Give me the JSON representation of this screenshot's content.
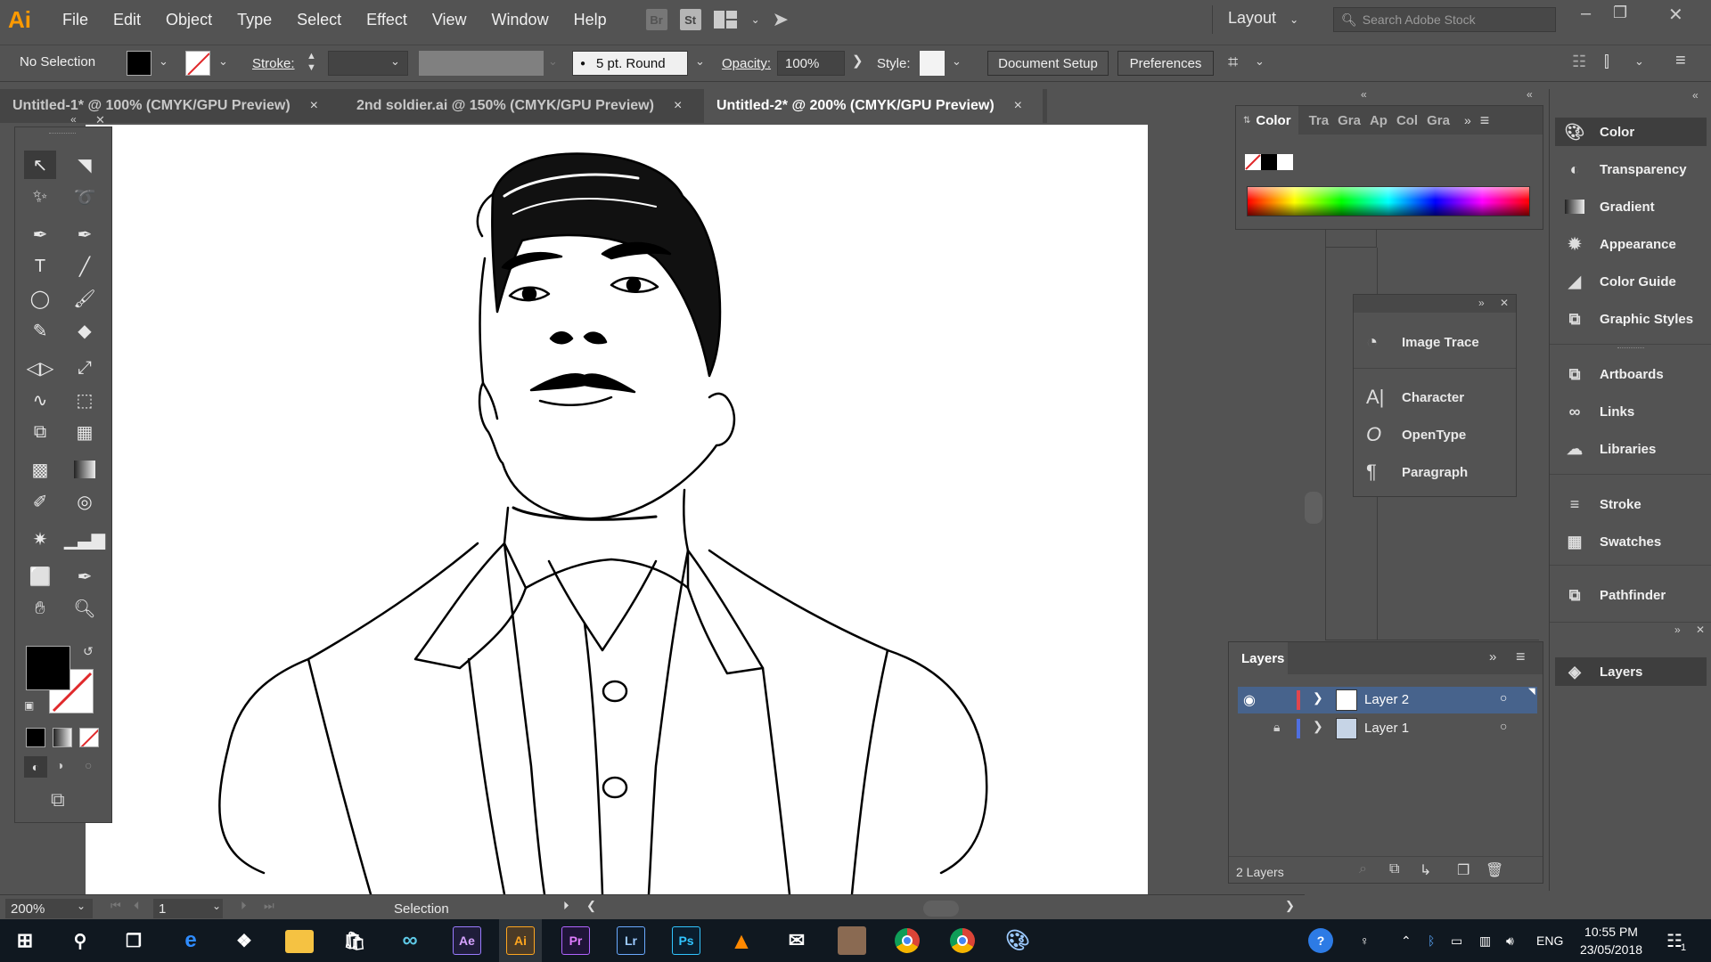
{
  "app": {
    "logo": "Ai"
  },
  "menu": [
    "File",
    "Edit",
    "Object",
    "Type",
    "Select",
    "Effect",
    "View",
    "Window",
    "Help"
  ],
  "menu_icons": {
    "bridge": "Br",
    "stock": "St"
  },
  "workspace": {
    "label": "Layout"
  },
  "search": {
    "placeholder": "Search Adobe Stock"
  },
  "control": {
    "selection": "No Selection",
    "stroke_label": "Stroke:",
    "brush": "5 pt. Round",
    "opacity_label": "Opacity:",
    "opacity_value": "100%",
    "style_label": "Style:",
    "document_setup": "Document Setup",
    "preferences": "Preferences"
  },
  "tabs": [
    {
      "label": "Untitled-1* @ 100% (CMYK/GPU Preview)",
      "close": "×"
    },
    {
      "label": "2nd soldier.ai @ 150% (CMYK/GPU Preview)",
      "close": "×"
    },
    {
      "label": "Untitled-2* @ 200% (CMYK/GPU Preview)",
      "close": "×"
    }
  ],
  "color_panel": {
    "title": "Color",
    "tabs": [
      "Tra",
      "Gra",
      "Ap",
      "Col",
      "Gra"
    ]
  },
  "floating_panel": {
    "items": [
      "Image Trace",
      "Character",
      "OpenType",
      "Paragraph"
    ]
  },
  "dock": {
    "items": [
      "Color",
      "Transparency",
      "Gradient",
      "Appearance",
      "Color Guide",
      "Graphic Styles",
      "Artboards",
      "Links",
      "Libraries",
      "Stroke",
      "Swatches",
      "Pathfinder",
      "Layers"
    ]
  },
  "layers_panel": {
    "title": "Layers",
    "layers": [
      "Layer 2",
      "Layer 1"
    ],
    "count": "2 Layers"
  },
  "status": {
    "zoom": "200%",
    "artboard": "1",
    "tool": "Selection"
  },
  "taskbar": {
    "apps": [
      "Ae",
      "Ai",
      "Pr",
      "Lr",
      "Ps"
    ],
    "lang": "ENG",
    "time": "10:55 PM",
    "date": "23/05/2018",
    "notif": "1"
  },
  "colors": {
    "ui_bg": "#535353",
    "artboard": "#ffffff",
    "ai_orange": "#ff9a00",
    "layer2_color": "#e0464e",
    "layer1_color": "#4f6fe0",
    "selected_row": "#47638c"
  }
}
